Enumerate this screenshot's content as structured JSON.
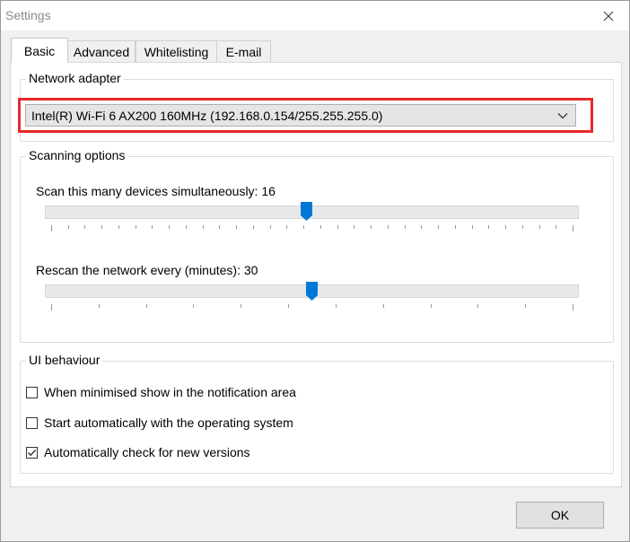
{
  "window": {
    "title": "Settings"
  },
  "tabs": [
    {
      "label": "Basic",
      "active": true
    },
    {
      "label": "Advanced",
      "active": false
    },
    {
      "label": "Whitelisting",
      "active": false
    },
    {
      "label": "E-mail",
      "active": false
    }
  ],
  "network_adapter": {
    "group_label": "Network adapter",
    "selected": "Intel(R) Wi-Fi 6 AX200 160MHz (192.168.0.154/255.255.255.0)",
    "highlight_color": "#e82a2a"
  },
  "scanning": {
    "group_label": "Scanning options",
    "simultaneous_label": "Scan this many devices simultaneously: 16",
    "simultaneous_fraction": 0.49,
    "rescan_label": "Rescan the network every (minutes): 30",
    "rescan_fraction": 0.5,
    "thumb_color": "#0078d7"
  },
  "ui_behaviour": {
    "group_label": "UI behaviour",
    "options": [
      {
        "label": "When minimised show in the notification area",
        "checked": false
      },
      {
        "label": "Start automatically with the operating system",
        "checked": false
      },
      {
        "label": "Automatically check for new versions",
        "checked": true
      }
    ]
  },
  "footer": {
    "ok_label": "OK"
  }
}
